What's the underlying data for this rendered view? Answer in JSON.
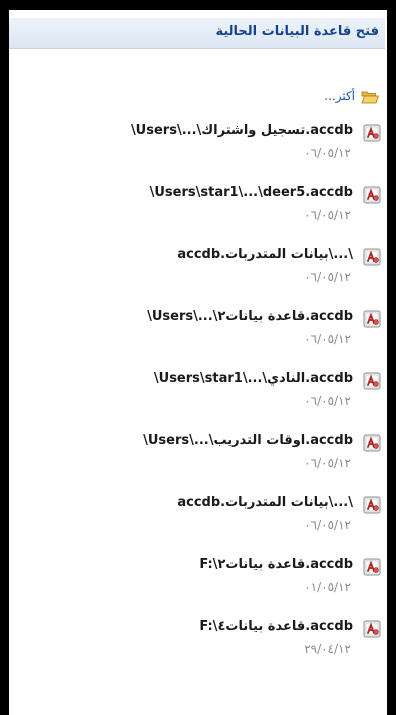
{
  "panel": {
    "title": "فتح قاعدة البيانات الحالية",
    "more_label": "أكثر..."
  },
  "recent_files": [
    {
      "path": "\\Users\\...\\تسجيل واشتراك.accdb",
      "date": "٠٦/٠٥/١٢"
    },
    {
      "path": "\\Users\\star1\\...\\deer5.accdb",
      "date": "٠٦/٠٥/١٢"
    },
    {
      "path": "\\...\\بيانات المتدربات.accdb",
      "date": "٠٦/٠٥/١٢"
    },
    {
      "path": "\\Users\\...\\قاعدة بيانات٢.accdb",
      "date": "٠٦/٠٥/١٢"
    },
    {
      "path": "\\Users\\star1\\...\\النادي.accdb",
      "date": "٠٦/٠٥/١٢"
    },
    {
      "path": "\\Users\\...\\اوقات التدريب.accdb",
      "date": "٠٦/٠٥/١٢"
    },
    {
      "path": "\\...\\بيانات المتدربات.accdb",
      "date": "٠٦/٠٥/١٢"
    },
    {
      "path": "F:\\قاعدة بيانات٢.accdb",
      "date": "٠١/٠٥/١٢"
    },
    {
      "path": "F:\\قاعدة بيانات٤.accdb",
      "date": "٢٩/٠٤/١٢"
    }
  ],
  "icons": {
    "folder": "open-folder-icon",
    "database": "access-database-icon"
  },
  "colors": {
    "header_text": "#15428b",
    "link": "#1e56b0",
    "date_text": "#8a8a8a",
    "icon_red": "#b22222"
  }
}
